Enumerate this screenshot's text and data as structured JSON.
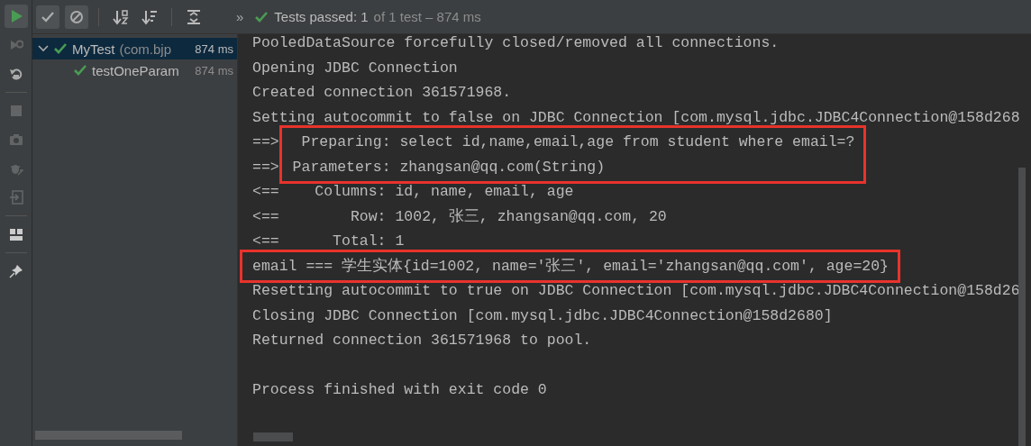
{
  "left_toolbar": [
    {
      "disabled": false
    },
    {
      "disabled": true
    },
    {
      "disabled": false
    },
    {
      "disabled": true
    },
    {
      "disabled": true
    },
    {
      "disabled": true
    },
    {
      "disabled": true
    },
    {
      "disabled": false
    },
    {
      "disabled": false
    }
  ],
  "top_toolbar": {
    "toggles": [
      {
        "selected": true
      },
      {
        "selected": true
      }
    ],
    "chevron": "»",
    "status": {
      "passed": true,
      "label": "Tests passed: 1",
      "detail": "of 1 test – 874 ms"
    }
  },
  "tree": [
    {
      "name": "MyTest",
      "package": "(com.bjp",
      "duration": "874 ms",
      "passed": true,
      "selected": true,
      "expanded": true,
      "children": [
        {
          "name": "testOneParam",
          "duration": "874 ms",
          "passed": true,
          "selected": false
        }
      ]
    }
  ],
  "console": {
    "blocks": [
      {
        "boxed": false,
        "lines": [
          "PooledDataSource forcefully closed/removed all connections.",
          "Opening JDBC Connection",
          "Created connection 361571968.",
          "Setting autocommit to false on JDBC Connection [com.mysql.jdbc.JDBC4Connection@158d268"
        ]
      },
      {
        "boxed": true,
        "prefixes": [
          "==>",
          "==>"
        ],
        "lines": [
          "  Preparing: select id,name,email,age from student where email=?",
          " Parameters: zhangsan@qq.com(String)"
        ]
      },
      {
        "boxed": false,
        "lines": [
          "<==    Columns: id, name, email, age",
          "<==        Row: 1002, 张三, zhangsan@qq.com, 20",
          "<==      Total: 1"
        ]
      },
      {
        "boxed": true,
        "lines": [
          "email === 学生实体{id=1002, name='张三', email='zhangsan@qq.com', age=20}"
        ]
      },
      {
        "boxed": false,
        "lines": [
          "Resetting autocommit to true on JDBC Connection [com.mysql.jdbc.JDBC4Connection@158d26",
          "Closing JDBC Connection [com.mysql.jdbc.JDBC4Connection@158d2680]",
          "Returned connection 361571968 to pool."
        ]
      }
    ],
    "exit_message": "Process finished with exit code 0"
  }
}
